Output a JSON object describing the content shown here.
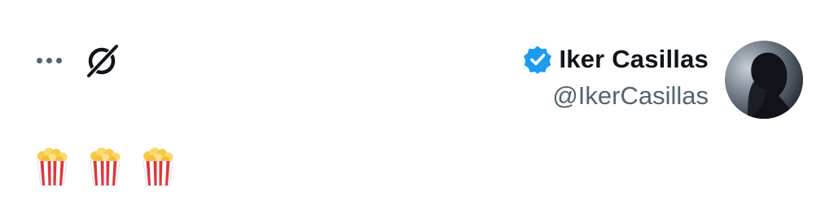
{
  "author": {
    "display_name": "Iker Casillas",
    "handle": "@IkerCasillas",
    "verified": true
  },
  "tweet": {
    "text": "🍿🍿🍿",
    "emojis": [
      "popcorn",
      "popcorn",
      "popcorn"
    ]
  },
  "icons": {
    "more": "more-horizontal-icon",
    "grok": "grok-icon",
    "verified": "verified-badge-icon",
    "popcorn": "popcorn-icon"
  },
  "colors": {
    "verified_blue": "#1d9bf0",
    "name_text": "#0f1419",
    "secondary_text": "#536471",
    "popcorn_red": "#e0353c"
  }
}
